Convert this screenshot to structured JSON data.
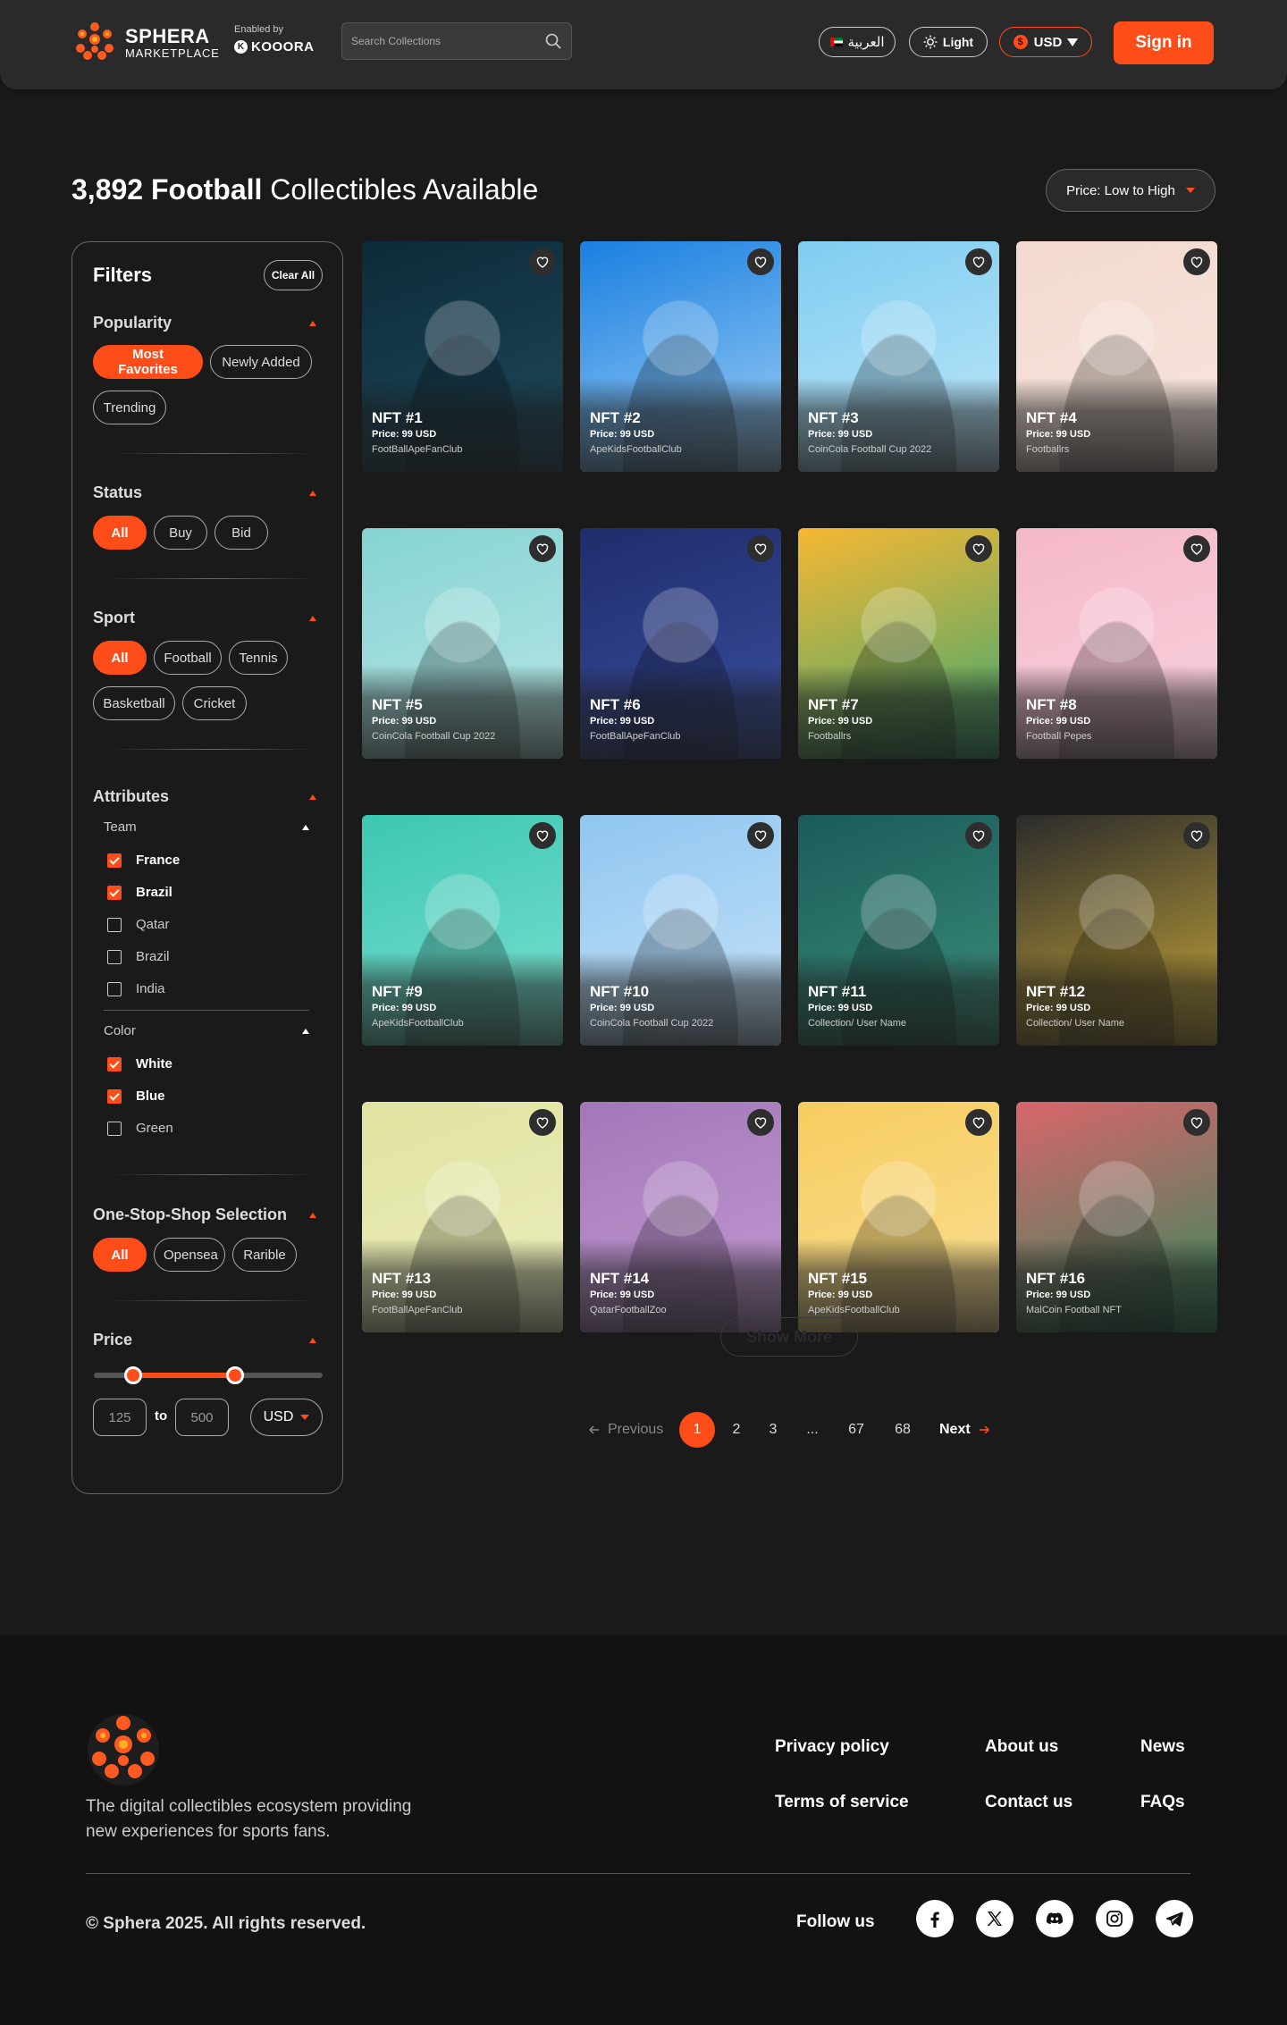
{
  "header": {
    "brand_name": "SPHERA",
    "brand_sub": "MARKETPLACE",
    "enabled_by": "Enabled by",
    "partner": "KOOORA",
    "search_placeholder": "Search Collections",
    "language": "العربية",
    "theme": "Light",
    "currency": "USD",
    "signin": "Sign in",
    "accent": "#ff4d1a"
  },
  "main": {
    "count": "3,892",
    "sport_word": "Football",
    "title_rest": "Collectibles Available",
    "sort_label": "Price: Low to High"
  },
  "filters": {
    "title": "Filters",
    "clear": "Clear All",
    "popularity": {
      "label": "Popularity",
      "options": [
        {
          "label": "Most Favorites",
          "selected": true
        },
        {
          "label": "Newly Added",
          "selected": false
        },
        {
          "label": "Trending",
          "selected": false
        }
      ]
    },
    "status": {
      "label": "Status",
      "options": [
        {
          "label": "All",
          "selected": true
        },
        {
          "label": "Buy",
          "selected": false
        },
        {
          "label": "Bid",
          "selected": false
        }
      ]
    },
    "sport": {
      "label": "Sport",
      "options": [
        {
          "label": "All",
          "selected": true
        },
        {
          "label": "Football",
          "selected": false
        },
        {
          "label": "Tennis",
          "selected": false
        },
        {
          "label": "Basketball",
          "selected": false
        },
        {
          "label": "Cricket",
          "selected": false
        }
      ]
    },
    "attributes": {
      "label": "Attributes",
      "team": {
        "label": "Team",
        "items": [
          {
            "label": "France",
            "checked": true
          },
          {
            "label": "Brazil",
            "checked": true
          },
          {
            "label": "Qatar",
            "checked": false
          },
          {
            "label": "Brazil",
            "checked": false
          },
          {
            "label": "India",
            "checked": false
          }
        ]
      },
      "color": {
        "label": "Color",
        "items": [
          {
            "label": "White",
            "checked": true
          },
          {
            "label": "Blue",
            "checked": true
          },
          {
            "label": "Green",
            "checked": false
          }
        ]
      }
    },
    "marketplace": {
      "label": "One-Stop-Shop Selection",
      "options": [
        {
          "label": "All",
          "selected": true
        },
        {
          "label": "Opensea",
          "selected": false
        },
        {
          "label": "Rarible",
          "selected": false
        }
      ]
    },
    "price": {
      "label": "Price",
      "min": "125",
      "to": "to",
      "max": "500",
      "currency": "USD"
    }
  },
  "nfts": [
    {
      "name": "NFT #1",
      "price": "Price: 99 USD",
      "collection": "FootBallApeFanClub",
      "icon": "ape-flame-icon",
      "colors": [
        "#0d2a3a",
        "#1f4a5c"
      ]
    },
    {
      "name": "NFT #2",
      "price": "Price: 99 USD",
      "collection": "ApeKidsFootballClub",
      "icon": "ape-kid-rainbow-icon",
      "colors": [
        "#1a7fe0",
        "#9fd0f5"
      ]
    },
    {
      "name": "NFT #3",
      "price": "Price: 99 USD",
      "collection": "CoinCola Football Cup 2022",
      "icon": "player-croatia-icon",
      "colors": [
        "#7fcdf0",
        "#bfe6f8"
      ]
    },
    {
      "name": "NFT #4",
      "price": "Price: 99 USD",
      "collection": "Footballrs",
      "icon": "lion-footballs-icon",
      "colors": [
        "#f3d9cf",
        "#f7e6dd"
      ]
    },
    {
      "name": "NFT #5",
      "price": "Price: 99 USD",
      "collection": "CoinCola Football Cup 2022",
      "icon": "player-argentina-icon",
      "colors": [
        "#86d3d3",
        "#b7e6e4"
      ]
    },
    {
      "name": "NFT #6",
      "price": "Price: 99 USD",
      "collection": "FootBallApeFanClub",
      "icon": "ape-trophy-icon",
      "colors": [
        "#1e2d6b",
        "#3b4fa0"
      ]
    },
    {
      "name": "NFT #7",
      "price": "Price: 99 USD",
      "collection": "Footballrs",
      "icon": "cat-runner-icon",
      "colors": [
        "#f7b733",
        "#3aa772"
      ]
    },
    {
      "name": "NFT #8",
      "price": "Price: 99 USD",
      "collection": "Football Pepes",
      "icon": "pepe-halo-icon",
      "colors": [
        "#f4b8c8",
        "#f9d2dd"
      ]
    },
    {
      "name": "NFT #9",
      "price": "Price: 99 USD",
      "collection": "ApeKidsFootballClub",
      "icon": "ape-kid-icon",
      "colors": [
        "#3cc7b3",
        "#7de0cf"
      ]
    },
    {
      "name": "NFT #10",
      "price": "Price: 99 USD",
      "collection": "CoinCola Football Cup 2022",
      "icon": "player-portugal-icon",
      "colors": [
        "#8fc6f0",
        "#c6e2f8"
      ]
    },
    {
      "name": "NFT #11",
      "price": "Price: 99 USD",
      "collection": "Collection/ User Name",
      "icon": "player-finland-icon",
      "colors": [
        "#1a5b5a",
        "#3c8f7a"
      ]
    },
    {
      "name": "NFT #12",
      "price": "Price: 99 USD",
      "collection": "Collection/ User Name",
      "icon": "player-belgium-icon",
      "colors": [
        "#2b2b2b",
        "#c9a93a"
      ]
    },
    {
      "name": "NFT #13",
      "price": "Price: 99 USD",
      "collection": "FootBallApeFanClub",
      "icon": "ape-laser-icon",
      "colors": [
        "#e0e3a0",
        "#eceebe"
      ]
    },
    {
      "name": "NFT #14",
      "price": "Price: 99 USD",
      "collection": "QatarFootballZoo",
      "icon": "lion-qatar-icon",
      "colors": [
        "#a277b8",
        "#c39bd3"
      ]
    },
    {
      "name": "NFT #15",
      "price": "Price: 99 USD",
      "collection": "ApeKidsFootballClub",
      "icon": "ape-kid-purple-icon",
      "colors": [
        "#f6cc5e",
        "#f9df95"
      ]
    },
    {
      "name": "NFT #16",
      "price": "Price: 99 USD",
      "collection": "MalCoin Football NFT",
      "icon": "stadium-goal-icon",
      "colors": [
        "#d9656b",
        "#2f8a5c"
      ]
    }
  ],
  "hidden_button": "Show More",
  "pagination": {
    "previous": "Previous",
    "next": "Next",
    "pages": [
      "1",
      "2",
      "3",
      "...",
      "67",
      "68"
    ],
    "current": "1"
  },
  "footer": {
    "tagline": "The digital collectibles ecosystem providing new experiences for sports fans.",
    "links": [
      "Privacy policy",
      "About us",
      "News",
      "Terms of service",
      "Contact us",
      "FAQs"
    ],
    "copyright": "© Sphera 2025. All rights reserved.",
    "follow": "Follow us",
    "socials": [
      "facebook-icon",
      "x-icon",
      "discord-icon",
      "instagram-icon",
      "telegram-icon"
    ]
  }
}
